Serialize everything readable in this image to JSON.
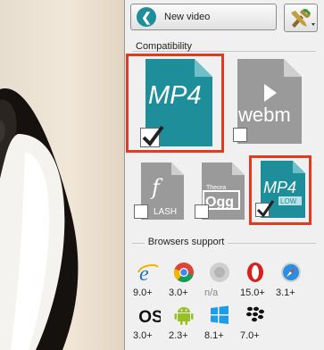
{
  "toolbar": {
    "new_video_label": "New video",
    "new_video_icon": "arrow-left-icon",
    "tools_icon": "tools-icon",
    "tools_menu_icon": "chevron-down-icon"
  },
  "compatibility": {
    "title": "Compatibility",
    "formats": [
      {
        "label": "MP4",
        "checked": true,
        "highlighted": true,
        "color": "#1f8e9b"
      },
      {
        "label": "webm",
        "checked": false,
        "highlighted": false,
        "color": "#9a9a9a"
      },
      {
        "label": "LASH",
        "checked": false,
        "highlighted": false,
        "color": "#9a9a9a"
      },
      {
        "label": "Ogg",
        "sublabel": "Theora",
        "checked": false,
        "highlighted": false,
        "color": "#9a9a9a"
      },
      {
        "label": "MP4",
        "sublabel": "LOW",
        "checked": true,
        "highlighted": true,
        "color": "#1f8e9b"
      }
    ]
  },
  "browsers_support": {
    "title": "Browsers support",
    "items": [
      {
        "icon": "internet-explorer-icon",
        "version": "9.0+"
      },
      {
        "icon": "chrome-icon",
        "version": "3.0+"
      },
      {
        "icon": "unknown-browser-icon",
        "version": "n/a"
      },
      {
        "icon": "opera-icon",
        "version": "15.0+"
      },
      {
        "icon": "safari-icon",
        "version": "3.1+"
      },
      {
        "icon": "ios-icon",
        "icon_text": "iOS",
        "version": "3.0+"
      },
      {
        "icon": "android-icon",
        "version": "2.3+"
      },
      {
        "icon": "windows-icon",
        "version": "8.1+"
      },
      {
        "icon": "blackberry-icon",
        "version": "7.0+"
      }
    ]
  },
  "colors": {
    "accent": "#1f8e9b",
    "selection": "#e03b1e",
    "inactive": "#9a9a9a"
  }
}
